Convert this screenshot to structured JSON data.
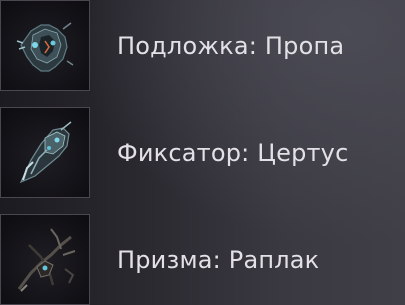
{
  "items": [
    {
      "label": "Подложка: Пропа",
      "icon": "propa-brace-part-icon"
    },
    {
      "label": "Фиксатор: Цертус",
      "icon": "certus-clasp-part-icon"
    },
    {
      "label": "Призма: Раплак",
      "icon": "raplak-prism-part-icon"
    }
  ],
  "colors": {
    "text": "#e3e1e6",
    "thumb_border": "#4a4750",
    "accent_glow": "#4fc3d9"
  }
}
